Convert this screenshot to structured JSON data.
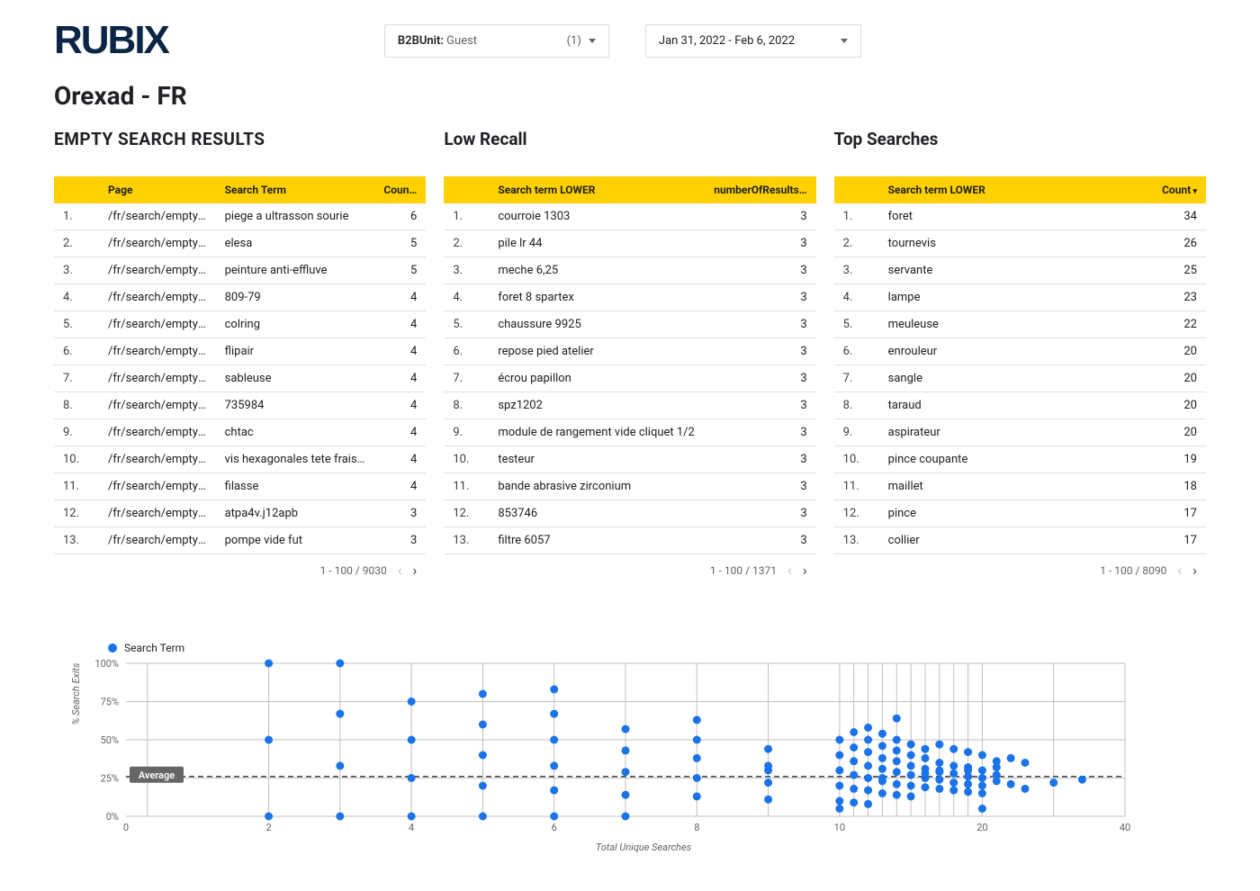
{
  "header": {
    "brand": "RUBIX",
    "b2b_label": "B2BUnit:",
    "b2b_value": "Guest",
    "b2b_count": "(1)",
    "date_range": "Jan 31, 2022 - Feb 6, 2022"
  },
  "page_title": "Orexad - FR",
  "tables": {
    "empty": {
      "title": "EMPTY SEARCH RESULTS",
      "cols": [
        "",
        "Page",
        "Search Term",
        "Coun…"
      ],
      "rows": [
        {
          "n": "1.",
          "page": "/fr/search/empty-res…",
          "term": "piege a ultrasson sourie",
          "count": 6
        },
        {
          "n": "2.",
          "page": "/fr/search/empty-res…",
          "term": "elesa",
          "count": 5
        },
        {
          "n": "3.",
          "page": "/fr/search/empty-res…",
          "term": "peinture anti-effluve",
          "count": 5
        },
        {
          "n": "4.",
          "page": "/fr/search/empty-res…",
          "term": "809-79",
          "count": 4
        },
        {
          "n": "5.",
          "page": "/fr/search/empty-res…",
          "term": "colring",
          "count": 4
        },
        {
          "n": "6.",
          "page": "/fr/search/empty-res…",
          "term": "flipair",
          "count": 4
        },
        {
          "n": "7.",
          "page": "/fr/search/empty-res…",
          "term": "sableuse",
          "count": 4
        },
        {
          "n": "8.",
          "page": "/fr/search/empty-res…",
          "term": "735984",
          "count": 4
        },
        {
          "n": "9.",
          "page": "/fr/search/empty-res…",
          "term": "chtac",
          "count": 4
        },
        {
          "n": "10.",
          "page": "/fr/search/empty-res…",
          "term": "vis hexagonales tete fraisee",
          "count": 4
        },
        {
          "n": "11.",
          "page": "/fr/search/empty-res…",
          "term": "filasse",
          "count": 4
        },
        {
          "n": "12.",
          "page": "/fr/search/empty-res…",
          "term": "atpa4v.j12apb",
          "count": 3
        },
        {
          "n": "13.",
          "page": "/fr/search/empty-res…",
          "term": "pompe vide fut",
          "count": 3
        }
      ],
      "pager": "1 - 100 / 9030"
    },
    "lowrecall": {
      "title": "Low Recall",
      "cols": [
        "",
        "Search term LOWER",
        "numberOfResults…"
      ],
      "rows": [
        {
          "n": "1.",
          "term": "courroie 1303",
          "count": 3
        },
        {
          "n": "2.",
          "term": "pile lr 44",
          "count": 3
        },
        {
          "n": "3.",
          "term": "meche 6,25",
          "count": 3
        },
        {
          "n": "4.",
          "term": "foret 8 spartex",
          "count": 3
        },
        {
          "n": "5.",
          "term": "chaussure 9925",
          "count": 3
        },
        {
          "n": "6.",
          "term": "repose pied atelier",
          "count": 3
        },
        {
          "n": "7.",
          "term": "écrou papillon",
          "count": 3
        },
        {
          "n": "8.",
          "term": "spz1202",
          "count": 3
        },
        {
          "n": "9.",
          "term": "module de rangement vide cliquet 1/2",
          "count": 3
        },
        {
          "n": "10.",
          "term": "testeur",
          "count": 3
        },
        {
          "n": "11.",
          "term": "bande abrasive zirconium",
          "count": 3
        },
        {
          "n": "12.",
          "term": "853746",
          "count": 3
        },
        {
          "n": "13.",
          "term": "filtre 6057",
          "count": 3
        }
      ],
      "pager": "1 - 100 / 1371"
    },
    "top": {
      "title": "Top Searches",
      "cols": [
        "",
        "Search term LOWER",
        "Count"
      ],
      "rows": [
        {
          "n": "1.",
          "term": "foret",
          "count": 34
        },
        {
          "n": "2.",
          "term": "tournevis",
          "count": 26
        },
        {
          "n": "3.",
          "term": "servante",
          "count": 25
        },
        {
          "n": "4.",
          "term": "lampe",
          "count": 23
        },
        {
          "n": "5.",
          "term": "meuleuse",
          "count": 22
        },
        {
          "n": "6.",
          "term": "enrouleur",
          "count": 20
        },
        {
          "n": "7.",
          "term": "sangle",
          "count": 20
        },
        {
          "n": "8.",
          "term": "taraud",
          "count": 20
        },
        {
          "n": "9.",
          "term": "aspirateur",
          "count": 20
        },
        {
          "n": "10.",
          "term": "pince coupante",
          "count": 19
        },
        {
          "n": "11.",
          "term": "maillet",
          "count": 18
        },
        {
          "n": "12.",
          "term": "pince",
          "count": 17
        },
        {
          "n": "13.",
          "term": "collier",
          "count": 17
        }
      ],
      "pager": "1 - 100 / 8090"
    }
  },
  "chart_data": {
    "type": "scatter",
    "legend": "Search Term",
    "xlabel": "Total Unique Searches",
    "ylabel": "% Search Exits",
    "xlim": [
      0,
      40
    ],
    "ylim": [
      0,
      100
    ],
    "xticks": [
      0,
      2,
      4,
      6,
      8,
      10,
      20,
      40
    ],
    "yticks": [
      0,
      25,
      50,
      75,
      100
    ],
    "xscale": "log-ish",
    "average_line_y": 26,
    "average_label": "Average",
    "vertical_gridlines_at": [
      0.3,
      2,
      3,
      4,
      5,
      6,
      7,
      8,
      9,
      10,
      11,
      12,
      13,
      14,
      15,
      16,
      17,
      18,
      19,
      20,
      30,
      40
    ],
    "series": [
      {
        "name": "Search Term",
        "points": [
          [
            2,
            100
          ],
          [
            2,
            50
          ],
          [
            2,
            0
          ],
          [
            3,
            100
          ],
          [
            3,
            67
          ],
          [
            3,
            33
          ],
          [
            3,
            0
          ],
          [
            4,
            75
          ],
          [
            4,
            50
          ],
          [
            4,
            25
          ],
          [
            4,
            0
          ],
          [
            5,
            80
          ],
          [
            5,
            60
          ],
          [
            5,
            40
          ],
          [
            5,
            20
          ],
          [
            5,
            0
          ],
          [
            6,
            83
          ],
          [
            6,
            67
          ],
          [
            6,
            50
          ],
          [
            6,
            33
          ],
          [
            6,
            17
          ],
          [
            6,
            0
          ],
          [
            7,
            57
          ],
          [
            7,
            43
          ],
          [
            7,
            29
          ],
          [
            7,
            14
          ],
          [
            7,
            0
          ],
          [
            8,
            63
          ],
          [
            8,
            50
          ],
          [
            8,
            38
          ],
          [
            8,
            25
          ],
          [
            8,
            13
          ],
          [
            9,
            44
          ],
          [
            9,
            33
          ],
          [
            9,
            30
          ],
          [
            9,
            22
          ],
          [
            9,
            11
          ],
          [
            10,
            50
          ],
          [
            10,
            40
          ],
          [
            10,
            30
          ],
          [
            10,
            20
          ],
          [
            10,
            10
          ],
          [
            10,
            5
          ],
          [
            11,
            55
          ],
          [
            11,
            45
          ],
          [
            11,
            36
          ],
          [
            11,
            27
          ],
          [
            11,
            18
          ],
          [
            11,
            9
          ],
          [
            12,
            58
          ],
          [
            12,
            50
          ],
          [
            12,
            42
          ],
          [
            12,
            33
          ],
          [
            12,
            25
          ],
          [
            12,
            17
          ],
          [
            12,
            8
          ],
          [
            13,
            54
          ],
          [
            13,
            46
          ],
          [
            13,
            38
          ],
          [
            13,
            31
          ],
          [
            13,
            23
          ],
          [
            13,
            15
          ],
          [
            13,
            25
          ],
          [
            14,
            64
          ],
          [
            14,
            50
          ],
          [
            14,
            43
          ],
          [
            14,
            36
          ],
          [
            14,
            29
          ],
          [
            14,
            21
          ],
          [
            14,
            14
          ],
          [
            15,
            47
          ],
          [
            15,
            40
          ],
          [
            15,
            33
          ],
          [
            15,
            27
          ],
          [
            15,
            20
          ],
          [
            15,
            13
          ],
          [
            16,
            44
          ],
          [
            16,
            38
          ],
          [
            16,
            31
          ],
          [
            16,
            25
          ],
          [
            16,
            19
          ],
          [
            16,
            28
          ],
          [
            17,
            47
          ],
          [
            17,
            35
          ],
          [
            17,
            29
          ],
          [
            17,
            24
          ],
          [
            17,
            18
          ],
          [
            17,
            30
          ],
          [
            18,
            44
          ],
          [
            18,
            33
          ],
          [
            18,
            28
          ],
          [
            18,
            22
          ],
          [
            18,
            17
          ],
          [
            19,
            42
          ],
          [
            19,
            32
          ],
          [
            19,
            26
          ],
          [
            19,
            21
          ],
          [
            19,
            16
          ],
          [
            19,
            30
          ],
          [
            20,
            30
          ],
          [
            20,
            25
          ],
          [
            20,
            20
          ],
          [
            20,
            15
          ],
          [
            20,
            5
          ],
          [
            20,
            40
          ],
          [
            22,
            36
          ],
          [
            22,
            27
          ],
          [
            22,
            23
          ],
          [
            22,
            32
          ],
          [
            24,
            38
          ],
          [
            24,
            21
          ],
          [
            26,
            18
          ],
          [
            26,
            35
          ],
          [
            30,
            22
          ],
          [
            34,
            24
          ]
        ]
      }
    ]
  }
}
